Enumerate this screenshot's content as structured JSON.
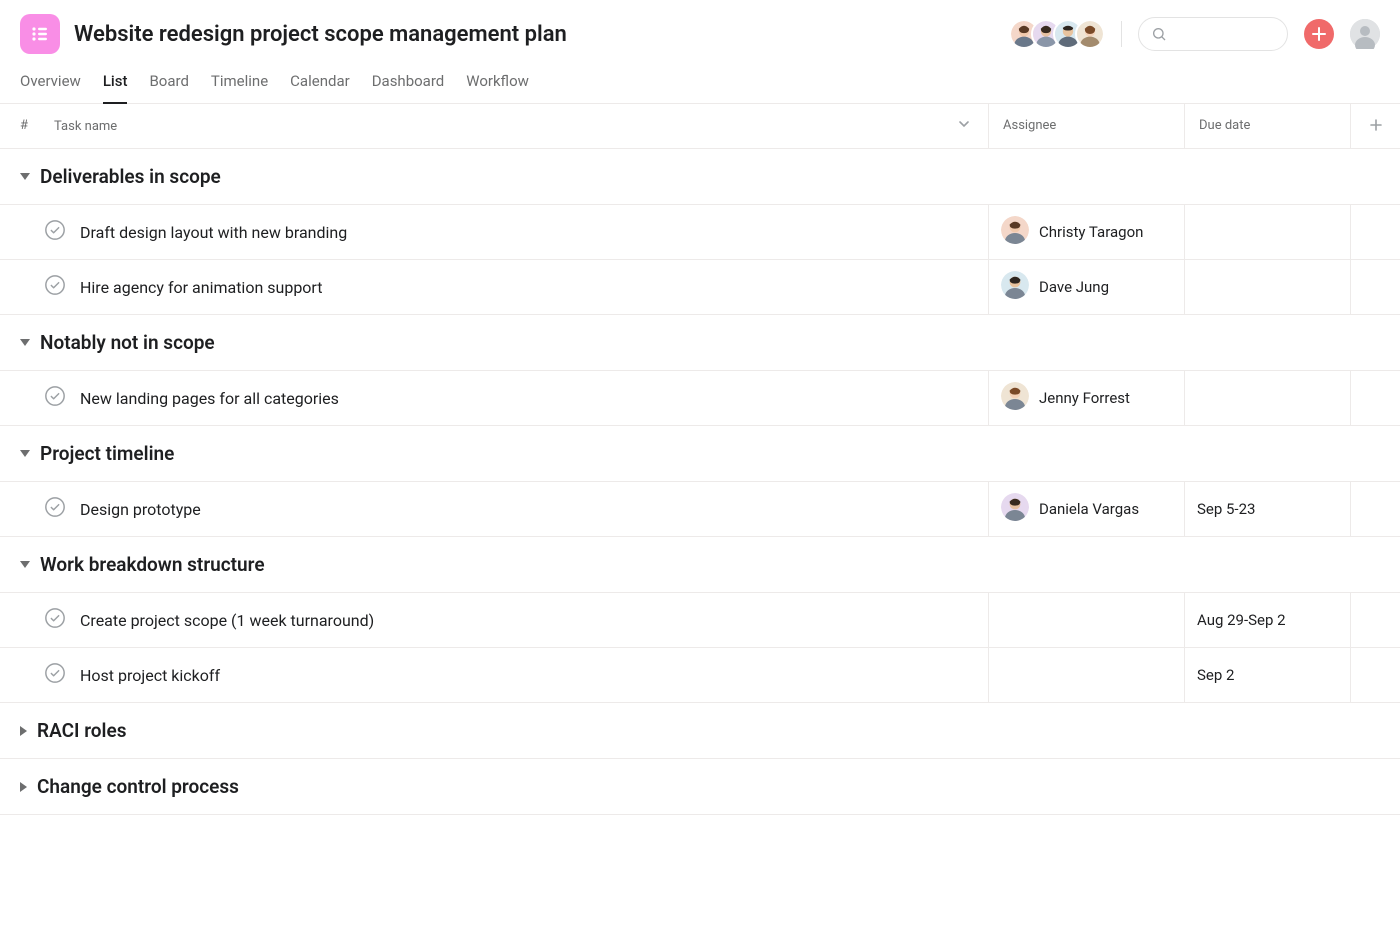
{
  "project": {
    "title": "Website redesign project scope management plan"
  },
  "tabs": [
    {
      "label": "Overview",
      "active": false
    },
    {
      "label": "List",
      "active": true
    },
    {
      "label": "Board",
      "active": false
    },
    {
      "label": "Timeline",
      "active": false
    },
    {
      "label": "Calendar",
      "active": false
    },
    {
      "label": "Dashboard",
      "active": false
    },
    {
      "label": "Workflow",
      "active": false
    }
  ],
  "columns": {
    "num": "#",
    "task": "Task name",
    "assignee": "Assignee",
    "due": "Due date"
  },
  "sections": [
    {
      "title": "Deliverables in scope",
      "expanded": true,
      "tasks": [
        {
          "name": "Draft design layout with new branding",
          "assignee": "Christy Taragon",
          "due": "",
          "avatar": "a1"
        },
        {
          "name": "Hire agency for animation support",
          "assignee": "Dave Jung",
          "due": "",
          "avatar": "a2"
        }
      ]
    },
    {
      "title": "Notably not in scope",
      "expanded": true,
      "tasks": [
        {
          "name": "New landing pages for all categories",
          "assignee": "Jenny Forrest",
          "due": "",
          "avatar": "a3"
        }
      ]
    },
    {
      "title": "Project timeline",
      "expanded": true,
      "tasks": [
        {
          "name": "Design prototype",
          "assignee": "Daniela Vargas",
          "due": "Sep 5-23",
          "avatar": "a4"
        }
      ]
    },
    {
      "title": "Work breakdown structure",
      "expanded": true,
      "tasks": [
        {
          "name": "Create project scope (1 week turnaround)",
          "assignee": "",
          "due": "Aug 29-Sep 2",
          "avatar": ""
        },
        {
          "name": "Host project kickoff",
          "assignee": "",
          "due": "Sep 2",
          "avatar": ""
        }
      ]
    },
    {
      "title": "RACI roles",
      "expanded": false,
      "tasks": []
    },
    {
      "title": "Change control process",
      "expanded": false,
      "tasks": []
    }
  ],
  "avatars": {
    "a1": {
      "bg": "#f4d7c9",
      "hair": "#5a3a25",
      "skin": "#f1c9ac"
    },
    "a2": {
      "bg": "#d8e8ef",
      "hair": "#2e2620",
      "skin": "#e8c39e"
    },
    "a3": {
      "bg": "#efe4d4",
      "hair": "#7a4a28",
      "skin": "#f4d2b8"
    },
    "a4": {
      "bg": "#e6d9ef",
      "hair": "#382a1f",
      "skin": "#e7c1a2"
    }
  }
}
